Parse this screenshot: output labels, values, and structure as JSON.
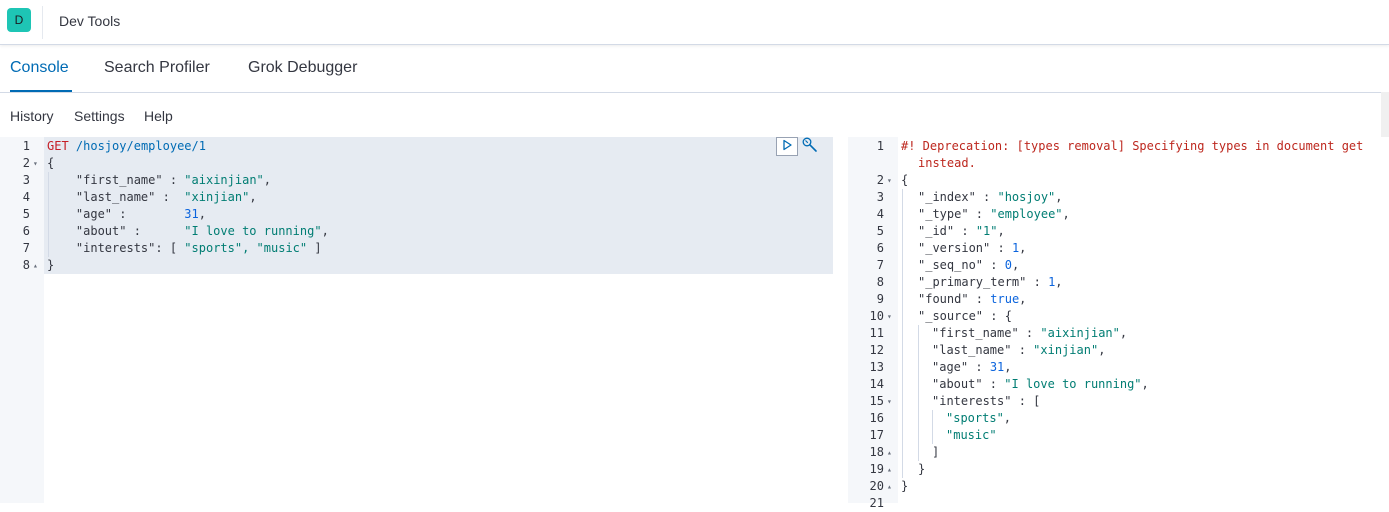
{
  "app": {
    "badge": "D",
    "title": "Dev Tools"
  },
  "tabs": [
    {
      "label": "Console",
      "active": true
    },
    {
      "label": "Search Profiler",
      "active": false
    },
    {
      "label": "Grok Debugger",
      "active": false
    }
  ],
  "subnav": {
    "history": "History",
    "settings": "Settings",
    "help": "Help"
  },
  "colors": {
    "accent": "#006bb4",
    "badge": "#1ec5b5",
    "string": "#017d73",
    "method": "#c61e25",
    "number": "#0b64dd"
  },
  "request": {
    "line_numbers": [
      "1",
      "2",
      "3",
      "4",
      "5",
      "6",
      "7",
      "8"
    ],
    "method": "GET",
    "path": "/hosjoy/employee/1",
    "open_brace": "{",
    "close_brace": "}",
    "fields": [
      {
        "key": "\"first_name\"",
        "sep": " : ",
        "value": "\"aixinjian\"",
        "trail": ","
      },
      {
        "key": "\"last_name\"",
        "sep": " :  ",
        "value": "\"xinjian\"",
        "trail": ","
      },
      {
        "key": "\"age\"",
        "sep": " :        ",
        "value": "31",
        "trail": ","
      },
      {
        "key": "\"about\"",
        "sep": " :      ",
        "value": "\"I love to running\"",
        "trail": ","
      },
      {
        "key": "\"interests\"",
        "sep": ": [ ",
        "value": "\"sports\", \"music\"",
        "trail": " ]"
      }
    ]
  },
  "response": {
    "line_numbers": [
      "1",
      "2",
      "3",
      "4",
      "5",
      "6",
      "7",
      "8",
      "9",
      "10",
      "11",
      "12",
      "13",
      "14",
      "15",
      "16",
      "17",
      "18",
      "19",
      "20",
      "21"
    ],
    "warning": "#! Deprecation: [types removal] Specifying types in document get",
    "warning_cont": "instead.",
    "lines": [
      {
        "key": "{",
        "value": "",
        "trail": ""
      },
      {
        "key": "\"_index\"",
        "value": "\"hosjoy\"",
        "trail": ","
      },
      {
        "key": "\"_type\"",
        "value": "\"employee\"",
        "trail": ","
      },
      {
        "key": "\"_id\"",
        "value": "\"1\"",
        "trail": ","
      },
      {
        "key": "\"_version\"",
        "value": "1",
        "trail": ","
      },
      {
        "key": "\"_seq_no\"",
        "value": "0",
        "trail": ","
      },
      {
        "key": "\"_primary_term\"",
        "value": "1",
        "trail": ","
      },
      {
        "key": "\"found\"",
        "value": "true",
        "trail": ","
      },
      {
        "key": "\"_source\"",
        "value": "{",
        "trail": ""
      },
      {
        "key": "\"first_name\"",
        "value": "\"aixinjian\"",
        "trail": ","
      },
      {
        "key": "\"last_name\"",
        "value": "\"xinjian\"",
        "trail": ","
      },
      {
        "key": "\"age\"",
        "value": "31",
        "trail": ","
      },
      {
        "key": "\"about\"",
        "value": "\"I love to running\"",
        "trail": ","
      },
      {
        "key": "\"interests\"",
        "value": "[",
        "trail": ""
      },
      {
        "key": "\"sports\"",
        "value": "",
        "trail": ","
      },
      {
        "key": "\"music\"",
        "value": "",
        "trail": ""
      },
      {
        "key": "]",
        "value": "",
        "trail": ""
      },
      {
        "key": "}",
        "value": "",
        "trail": ""
      },
      {
        "key": "}",
        "value": "",
        "trail": ""
      }
    ]
  },
  "icons": {
    "run": "play-icon",
    "settings": "wrench-icon"
  }
}
